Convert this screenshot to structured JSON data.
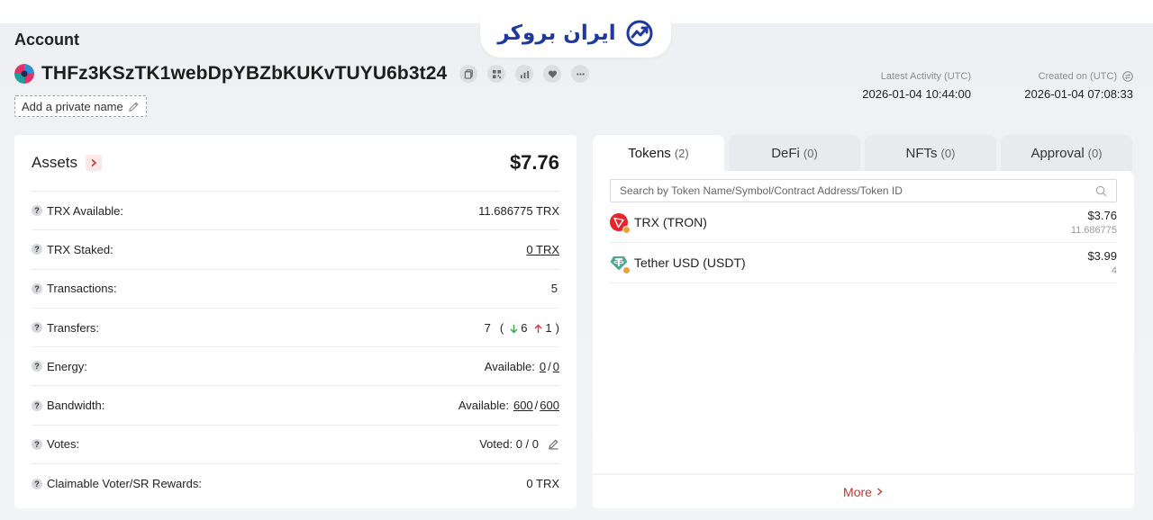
{
  "logo": {
    "text": "ایران بروکر"
  },
  "account": {
    "title": "Account",
    "address": "THFz3KSzTK1webDpYBZbKUKvTUYU6b3t24",
    "private_name_label": "Add a private name"
  },
  "meta": {
    "latest_label": "Latest Activity (UTC)",
    "latest_value": "2026-01-04 10:44:00",
    "created_label": "Created on (UTC)",
    "created_value": "2026-01-04 07:08:33"
  },
  "assets": {
    "title": "Assets",
    "total": "$7.76",
    "rows": [
      {
        "label": "TRX Available:",
        "value": "11.686775 TRX"
      },
      {
        "label": "TRX Staked:",
        "value": "0 TRX"
      },
      {
        "label": "Transactions:",
        "value": "5"
      },
      {
        "label": "Transfers:",
        "total": "7",
        "in": "6",
        "out": "1",
        "open": "(",
        "close": ")"
      },
      {
        "label": "Energy:",
        "prefix": "Available:",
        "used": "0",
        "sep": "/",
        "limit": "0"
      },
      {
        "label": "Bandwidth:",
        "prefix": "Available:",
        "used": "600",
        "sep": "/",
        "limit": "600"
      },
      {
        "label": "Votes:",
        "value": "Voted: 0 / 0"
      },
      {
        "label": "Claimable Voter/SR Rewards:",
        "value": "0 TRX"
      }
    ]
  },
  "tabs": [
    {
      "label": "Tokens",
      "count": "(2)"
    },
    {
      "label": "DeFi",
      "count": "(0)"
    },
    {
      "label": "NFTs",
      "count": "(0)"
    },
    {
      "label": "Approval",
      "count": "(0)"
    }
  ],
  "tokens": {
    "search_placeholder": "Search by Token Name/Symbol/Contract Address/Token ID",
    "items": [
      {
        "name": "TRX (TRON)",
        "usd": "$3.76",
        "amount": "11.686775"
      },
      {
        "name": "Tether USD (USDT)",
        "usd": "$3.99",
        "amount": "4"
      }
    ],
    "more_label": "More"
  },
  "colors": {
    "accent_red": "#c23631",
    "trx_red": "#e7262b",
    "usdt_green": "#4ea793",
    "arrow_in": "#2aa84a",
    "arrow_out": "#d9363e",
    "logo_blue": "#1f3a9e"
  },
  "icons": [
    "copy-icon",
    "qr-code-icon",
    "chart-icon",
    "heart-icon",
    "more-icon",
    "edit-icon",
    "chevron-right-icon",
    "search-icon",
    "help-icon",
    "arrow-down-icon",
    "arrow-up-icon",
    "trx-icon",
    "usdt-icon",
    "switch-icon"
  ]
}
